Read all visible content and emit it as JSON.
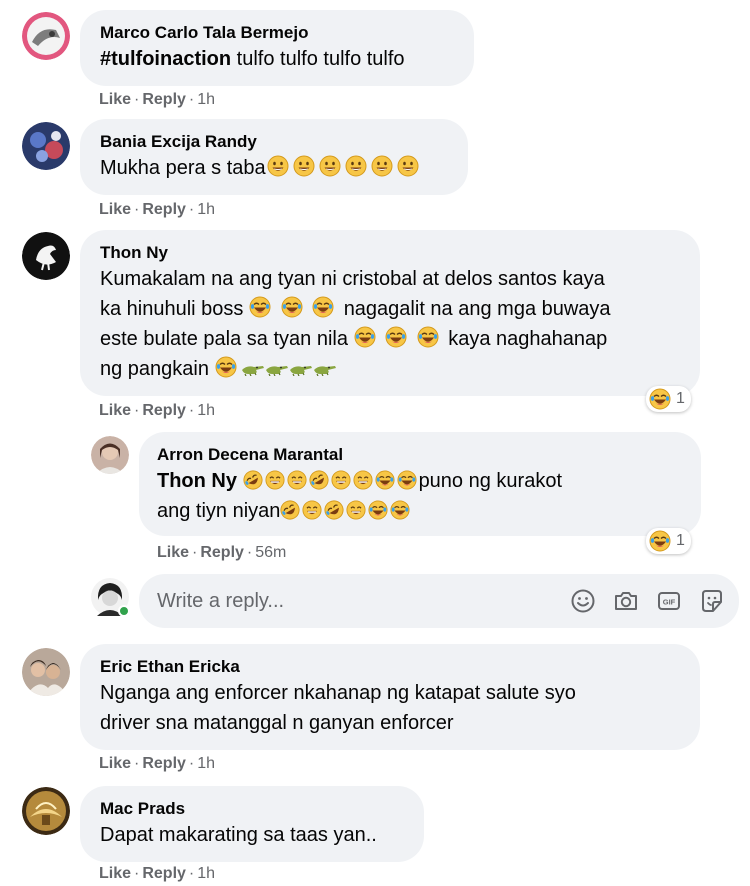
{
  "comments": [
    {
      "author": "Marco Carlo Tala Bermejo",
      "hashtag": "#tulfoinaction",
      "text": " tulfo tulfo tulfo tulfo",
      "like": "Like",
      "reply": "Reply",
      "time": "1h"
    },
    {
      "author": "Bania Excija Randy",
      "text": "Mukha pera s taba",
      "like": "Like",
      "reply": "Reply",
      "time": "1h"
    },
    {
      "author": "Thon Ny",
      "line1": "Kumakalam na ang tyan ni cristobal at delos santos kaya",
      "line2a": "ka hinuhuli boss",
      "line2b": "nagagalit na ang mga buwaya",
      "line3a": "este bulate pala sa tyan nila",
      "line3b": "kaya naghahanap",
      "line4": "ng pangkain",
      "reaction_count": "1",
      "like": "Like",
      "reply": "Reply",
      "time": "1h"
    },
    {
      "author": "Arron Decena Marantal",
      "mention": "Thon Ny",
      "text1": "puno ng kurakot",
      "text2": "ang tiyn niyan",
      "reaction_count": "1",
      "like": "Like",
      "reply": "Reply",
      "time": "56m"
    },
    {
      "author": "Eric Ethan Ericka",
      "line1": "Nganga ang enforcer nkahanap ng katapat salute syo",
      "line2": "driver sna matanggal n ganyan enforcer",
      "like": "Like",
      "reply": "Reply",
      "time": "1h"
    },
    {
      "author": "Mac Prads",
      "text": "Dapat makarating sa taas yan..",
      "like": "Like",
      "reply": "Reply",
      "time": "1h"
    }
  ],
  "reply_box": {
    "placeholder": "Write a reply...",
    "icons": [
      "smiley-icon",
      "camera-icon",
      "gif-icon",
      "sticker-icon"
    ]
  },
  "colors": {
    "bubble": "#f0f2f5",
    "meta": "#65676b",
    "online": "#31a24c"
  }
}
